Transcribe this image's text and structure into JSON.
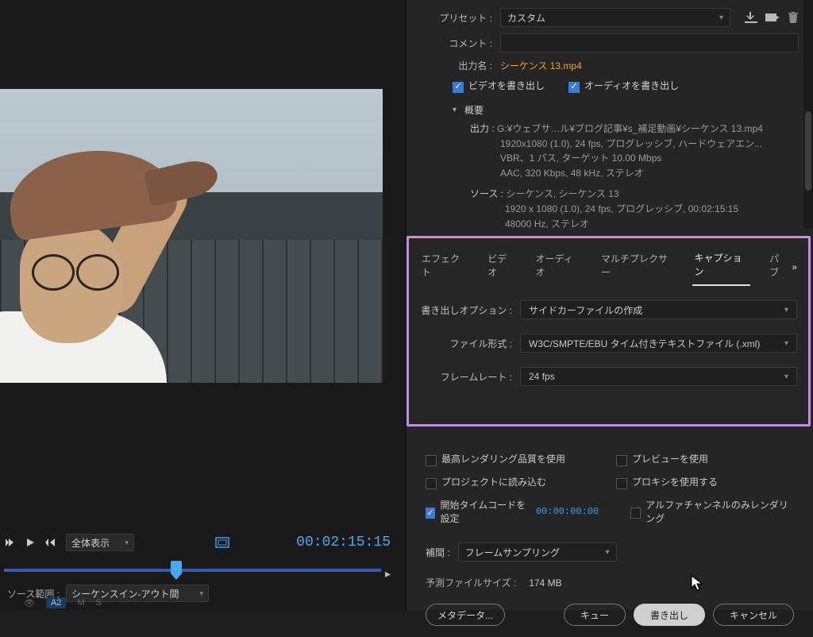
{
  "preset": {
    "label": "プリセット :",
    "value": "カスタム"
  },
  "comment": {
    "label": "コメント :"
  },
  "output_name": {
    "label": "出力名 :",
    "value": "シーケンス 13.mp4"
  },
  "export_video": "ビデオを書き出し",
  "export_audio": "オーディオを書き出し",
  "summary": {
    "title": "概要",
    "output_label": "出力 :",
    "output_text1": "G:¥ウェブサ…ル¥ブログ記事¥s_補足動画¥シーケンス 13.mp4",
    "output_text2": "1920x1080 (1.0), 24 fps, プログレッシブ, ハードウェアエン...",
    "output_text3": "VBR、1 パス, ターゲット 10.00 Mbps",
    "output_text4": "AAC, 320 Kbps, 48 kHz, ステレオ",
    "source_label": "ソース :",
    "source_text1": "シーケンス, シーケンス 13",
    "source_text2": "1920 x 1080 (1.0), 24 fps, プログレッシブ, 00:02:15:15",
    "source_text3": "48000 Hz, ステレオ"
  },
  "tabs": {
    "effects": "エフェクト",
    "video": "ビデオ",
    "audio": "オーディオ",
    "multiplexer": "マルチプレクサー",
    "caption": "キャプション",
    "publish": "パブ"
  },
  "caption_panel": {
    "export_option_label": "書き出しオプション :",
    "export_option_value": "サイドカーファイルの作成",
    "file_format_label": "ファイル形式 :",
    "file_format_value": "W3C/SMPTE/EBU タイム付きテキストファイル (.xml)",
    "framerate_label": "フレームレート :",
    "framerate_value": "24 fps"
  },
  "options": {
    "max_render": "最高レンダリング品質を使用",
    "use_preview": "プレビューを使用",
    "import_project": "プロジェクトに読み込む",
    "use_proxy": "プロキシを使用する",
    "start_timecode": "開始タイムコードを設定",
    "timecode_value": "00:00:00:00",
    "alpha_only": "アルファチャンネルのみレンダリング"
  },
  "interp": {
    "label": "補間 :",
    "value": "フレームサンプリング"
  },
  "filesize": {
    "label": "予測ファイルサイズ :",
    "value": "174 MB"
  },
  "buttons": {
    "metadata": "メタデータ...",
    "queue": "キュー",
    "export": "書き出し",
    "cancel": "キャンセル"
  },
  "playbar": {
    "fit": "全体表示",
    "timecode": "00:02:15:15",
    "source_range_label": "ソース範囲 :",
    "source_range_value": "シーケンスイン-アウト間",
    "audio_chip": "A2"
  }
}
